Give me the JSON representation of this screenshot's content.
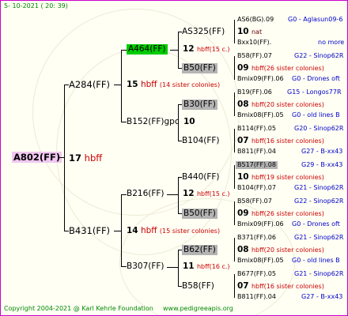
{
  "date": "5- 10-2021 ( 20: 39)",
  "copyright": "Copyright 2004-2021 @ Karl Kehrle Foundation",
  "website": "www.pedigreeapis.org",
  "root": {
    "name": "A802(FF)",
    "num": "17",
    "label": "hbff"
  },
  "gen1": {
    "top": {
      "name": "A284(FF)",
      "num": "15",
      "label": "hbff",
      "note": "(14 sister colonies)"
    },
    "bot": {
      "name": "B431(FF)",
      "num": "14",
      "label": "hbff",
      "note": "(15 sister colonies)"
    }
  },
  "gen2": {
    "a": {
      "name": "A464(FF)",
      "num": "12",
      "label": "hbff",
      "note": "(15 c.)"
    },
    "b": {
      "name": "B152(FF)gpc",
      "num": "10"
    },
    "c": {
      "name": "B216(FF)",
      "num": "12",
      "label": "hbff",
      "note": "(15 c.)"
    },
    "d": {
      "name": "B307(FF)",
      "num": "11",
      "label": "hbff",
      "note": "(16 c.)"
    }
  },
  "gen3": {
    "a1": {
      "name": "AS325(FF)",
      "num": "10",
      "label": "nat",
      "top": "AS6(BG).09",
      "top_info": "G0 - Aglasun09-6",
      "bot": "Bxx10(FF).",
      "bot_info": "no more"
    },
    "a2": {
      "name": "B50(FF)",
      "num": "09",
      "label": "hbff",
      "note": "(26 sister colonies)",
      "top": "B58(FF).07",
      "top_info": "G22 - Sinop62R",
      "bot": "Bmix09(FF).06",
      "bot_info": "G0 - Drones oft"
    },
    "b1": {
      "name": "B30(FF)",
      "num": "08",
      "label": "hbff",
      "note": "(20 sister colonies)",
      "top": "B19(FF).06",
      "top_info": "G15 - Longos77R",
      "bot": "Bmix08(FF).05",
      "bot_info": "G0 - old lines B"
    },
    "b2": {
      "name": "B104(FF)",
      "num": "07",
      "label": "hbff",
      "note": "(16 sister colonies)",
      "top": "B114(FF).05",
      "top_info": "G20 - Sinop62R",
      "bot": "B811(FF).04",
      "bot_info": "G27 - B-xx43"
    },
    "c1": {
      "name": "B440(FF)",
      "num": "10",
      "label": "hbff",
      "note": "(19 sister colonies)",
      "top": "B517(FF).08",
      "top_info": "G29 - B-xx43",
      "bot": "B104(FF).07",
      "bot_info": "G21 - Sinop62R"
    },
    "c2": {
      "name": "B50(FF)",
      "num": "09",
      "label": "hbff",
      "note": "(26 sister colonies)",
      "top": "B58(FF).07",
      "top_info": "G22 - Sinop62R",
      "bot": "Bmix09(FF).06",
      "bot_info": "G0 - Drones oft"
    },
    "d1": {
      "name": "B62(FF)",
      "num": "08",
      "label": "hbff",
      "note": "(20 sister colonies)",
      "top": "B371(FF).06",
      "top_info": "G21 - Sinop62R",
      "bot": "Bmix08(FF).05",
      "bot_info": "G0 - old lines B"
    },
    "d2": {
      "name": "B58(FF)",
      "num": "07",
      "label": "hbff",
      "note": "(16 sister colonies)",
      "top": "B677(FF).05",
      "top_info": "G21 - Sinop62R",
      "bot": "B811(FF).04",
      "bot_info": "G27 - B-xx43"
    }
  },
  "colors": {
    "frame": "#cc00cc",
    "root_bg": "#f0c8f0",
    "green_bg": "#00cc00",
    "grey_bg": "#b4b4b4",
    "blue": "#0000cc",
    "red": "#cc0000",
    "date": "#008800"
  }
}
